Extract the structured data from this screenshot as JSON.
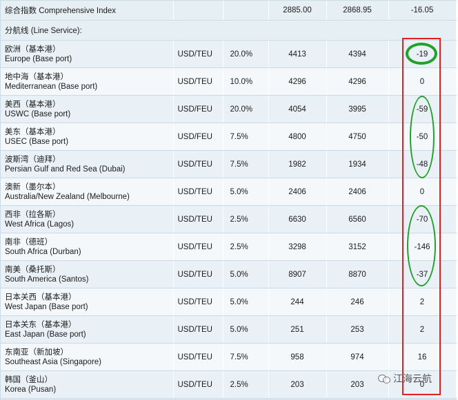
{
  "header": {
    "label": "综合指数 Comprehensive Index",
    "prev": "2885.00",
    "curr": "2868.95",
    "change": "-16.05"
  },
  "subheader": {
    "label": "分航线 (Line Service):"
  },
  "rows": [
    {
      "cn": "欧洲（基本港）",
      "en": "Europe (Base port)",
      "unit": "USD/TEU",
      "weight": "20.0%",
      "prev": "4413",
      "curr": "4394",
      "change": "-19"
    },
    {
      "cn": "地中海（基本港）",
      "en": "Mediterranean (Base port)",
      "unit": "USD/TEU",
      "weight": "10.0%",
      "prev": "4296",
      "curr": "4296",
      "change": "0"
    },
    {
      "cn": "美西（基本港）",
      "en": "USWC (Base port)",
      "unit": "USD/FEU",
      "weight": "20.0%",
      "prev": "4054",
      "curr": "3995",
      "change": "-59"
    },
    {
      "cn": "美东（基本港）",
      "en": "USEC (Base port)",
      "unit": "USD/FEU",
      "weight": "7.5%",
      "prev": "4800",
      "curr": "4750",
      "change": "-50"
    },
    {
      "cn": "波斯湾（迪拜）",
      "en": "Persian Gulf and Red Sea (Dubai)",
      "unit": "USD/TEU",
      "weight": "7.5%",
      "prev": "1982",
      "curr": "1934",
      "change": "-48"
    },
    {
      "cn": "澳新（墨尔本）",
      "en": "Australia/New Zealand (Melbourne)",
      "unit": "USD/TEU",
      "weight": "5.0%",
      "prev": "2406",
      "curr": "2406",
      "change": "0"
    },
    {
      "cn": "西非（拉各斯）",
      "en": "West Africa (Lagos)",
      "unit": "USD/TEU",
      "weight": "2.5%",
      "prev": "6630",
      "curr": "6560",
      "change": "-70"
    },
    {
      "cn": "南非（德班）",
      "en": "South Africa (Durban)",
      "unit": "USD/TEU",
      "weight": "2.5%",
      "prev": "3298",
      "curr": "3152",
      "change": "-146"
    },
    {
      "cn": "南美（桑托斯）",
      "en": "South America (Santos)",
      "unit": "USD/TEU",
      "weight": "5.0%",
      "prev": "8907",
      "curr": "8870",
      "change": "-37"
    },
    {
      "cn": "日本关西（基本港）",
      "en": "West Japan (Base port)",
      "unit": "USD/TEU",
      "weight": "5.0%",
      "prev": "244",
      "curr": "246",
      "change": "2"
    },
    {
      "cn": "日本关东（基本港）",
      "en": "East Japan (Base port)",
      "unit": "USD/TEU",
      "weight": "5.0%",
      "prev": "251",
      "curr": "253",
      "change": "2"
    },
    {
      "cn": "东南亚（新加坡）",
      "en": "Southeast Asia (Singapore)",
      "unit": "USD/TEU",
      "weight": "7.5%",
      "prev": "958",
      "curr": "974",
      "change": "16"
    },
    {
      "cn": "韩国（釜山）",
      "en": "Korea (Pusan)",
      "unit": "USD/TEU",
      "weight": "2.5%",
      "prev": "203",
      "curr": "203",
      "change": "0"
    }
  ],
  "watermark": {
    "text": "江海云航"
  },
  "colors": {
    "annotation_red": "#e02020",
    "annotation_green": "#22a02a",
    "row_bg": "#e9f1f6",
    "border": "#c9dbe6"
  }
}
